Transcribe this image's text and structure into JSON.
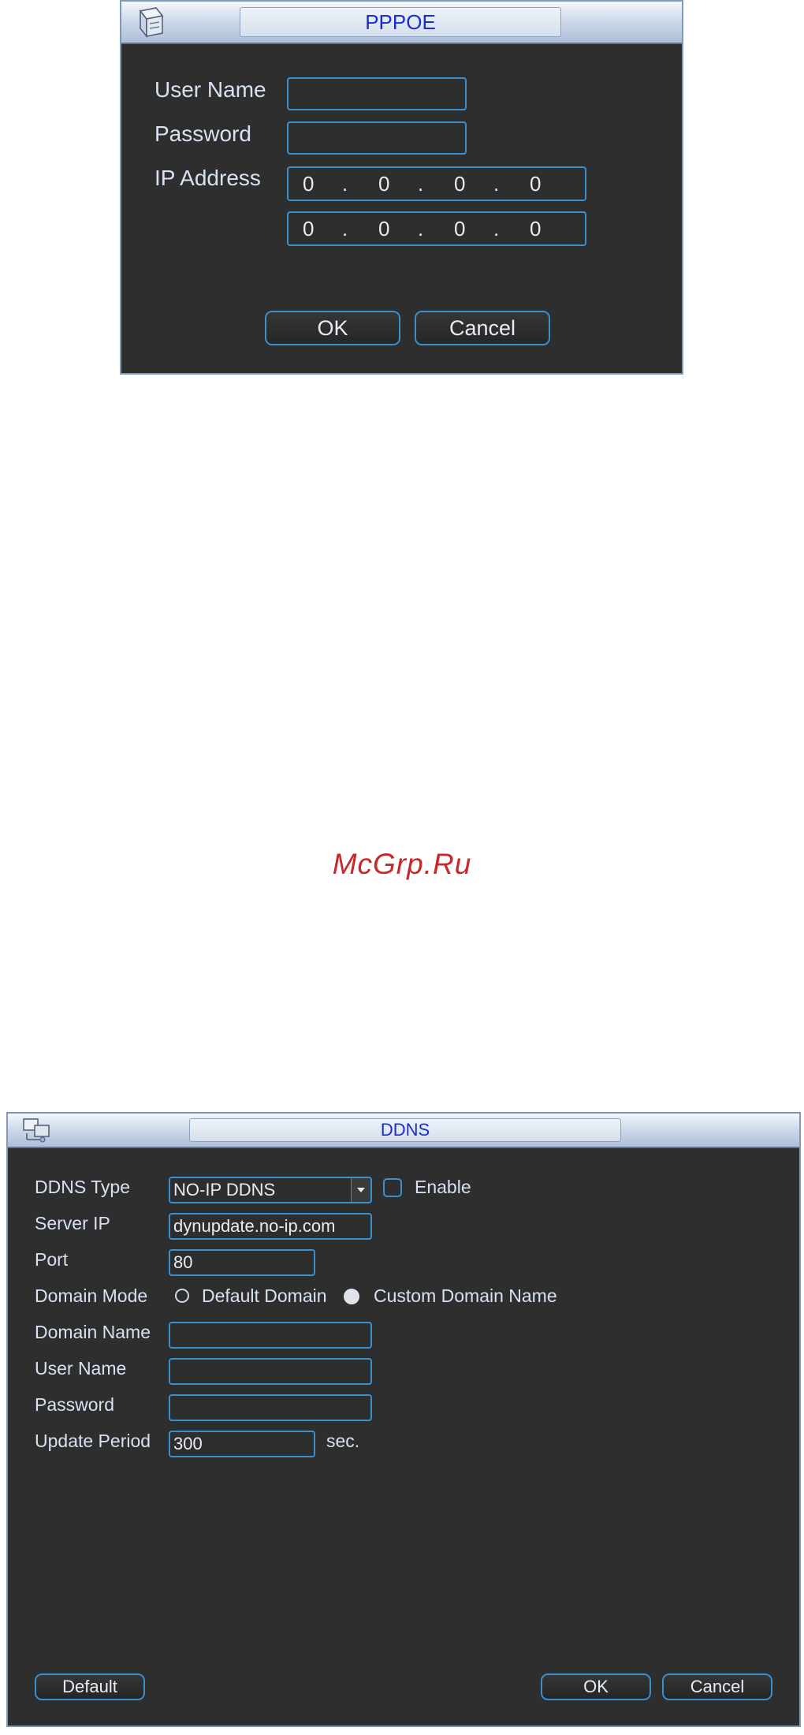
{
  "pppoe": {
    "title": "PPPOE",
    "labels": {
      "user_name": "User Name",
      "password": "Password",
      "ip_address": "IP Address"
    },
    "user_name_value": "",
    "password_value": "",
    "ip_rows": [
      {
        "o1": "0",
        "o2": "0",
        "o3": "0",
        "o4": "0"
      },
      {
        "o1": "0",
        "o2": "0",
        "o3": "0",
        "o4": "0"
      }
    ],
    "ip_separator": ".",
    "buttons": {
      "ok": "OK",
      "cancel": "Cancel"
    }
  },
  "watermark": "McGrp.Ru",
  "ddns": {
    "title": "DDNS",
    "labels": {
      "ddns_type": "DDNS Type",
      "server_ip": "Server IP",
      "port": "Port",
      "domain_mode": "Domain Mode",
      "domain_name": "Domain Name",
      "user_name": "User Name",
      "password": "Password",
      "update_period": "Update Period"
    },
    "ddns_type_value": "NO-IP DDNS",
    "enable_label": "Enable",
    "enable_checked": false,
    "server_ip_value": "dynupdate.no-ip.com",
    "port_value": "80",
    "domain_mode_options": [
      {
        "label": "Default Domain",
        "selected": false
      },
      {
        "label": "Custom Domain Name",
        "selected": true
      }
    ],
    "domain_name_value": "",
    "user_name_value": "",
    "password_value": "",
    "update_period_value": "300",
    "update_period_unit": "sec.",
    "buttons": {
      "default": "Default",
      "ok": "OK",
      "cancel": "Cancel"
    }
  },
  "colors": {
    "panel_bg": "#2e2e2e",
    "field_border": "#3a8fd0",
    "label_text": "#d6e2f3",
    "title_text": "#1a2ecb",
    "watermark": "#c8282a"
  }
}
